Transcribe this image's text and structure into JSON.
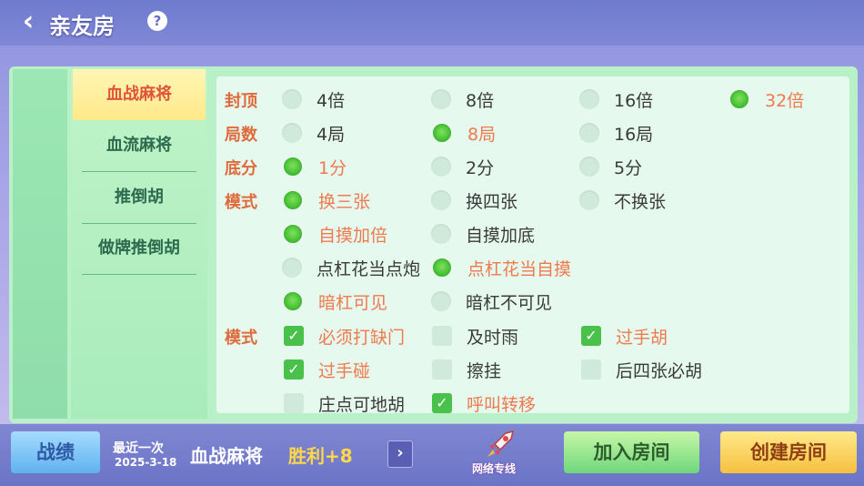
{
  "header": {
    "back_icon": "chevron-left-icon",
    "title": "亲友房",
    "help_icon": "?"
  },
  "sidebar": {
    "items": [
      {
        "label": "血战麻将",
        "active": true
      },
      {
        "label": "血流麻将",
        "active": false
      },
      {
        "label": "推倒胡",
        "active": false
      },
      {
        "label": "做牌推倒胡",
        "active": false
      }
    ]
  },
  "settings": {
    "fengding": {
      "label": "封顶",
      "options": [
        "4倍",
        "8倍",
        "16倍",
        "32倍"
      ],
      "selected": "32倍"
    },
    "jushu": {
      "label": "局数",
      "options": [
        "4局",
        "8局",
        "16局"
      ],
      "selected": "8局"
    },
    "difen": {
      "label": "底分",
      "options": [
        "1分",
        "2分",
        "5分"
      ],
      "selected": "1分"
    },
    "moshi": {
      "label": "模式",
      "huan": {
        "options": [
          "换三张",
          "换四张",
          "不换张"
        ],
        "selected": "换三张"
      },
      "zimo": {
        "options": [
          "自摸加倍",
          "自摸加底"
        ],
        "selected": "自摸加倍"
      },
      "dianggang": {
        "options": [
          "点杠花当点炮",
          "点杠花当自摸"
        ],
        "selected": "点杠花当自摸"
      },
      "angang": {
        "options": [
          "暗杠可见",
          "暗杠不可见"
        ],
        "selected": "暗杠可见"
      }
    },
    "moshi2": {
      "label": "模式",
      "checks": [
        {
          "label": "必须打缺门",
          "checked": true
        },
        {
          "label": "及时雨",
          "checked": false
        },
        {
          "label": "过手胡",
          "checked": true
        },
        {
          "label": "过手碰",
          "checked": true
        },
        {
          "label": "擦挂",
          "checked": false
        },
        {
          "label": "后四张必胡",
          "checked": false
        },
        {
          "label": "庄点可地胡",
          "checked": false
        },
        {
          "label": "呼叫转移",
          "checked": true
        }
      ]
    }
  },
  "footer": {
    "record_label": "战绩",
    "last_label": "最近一次",
    "last_date": "2025-3-18",
    "last_game": "血战麻将",
    "last_result": "胜利+8",
    "more_icon": "chevron-right-icon",
    "network_label": "网络专线",
    "join_label": "加入房间",
    "create_label": "创建房间"
  },
  "colors": {
    "accent_orange": "#ef7a4e",
    "radio_on": "#3bb82f",
    "panel_green": "#b8f0c7"
  }
}
